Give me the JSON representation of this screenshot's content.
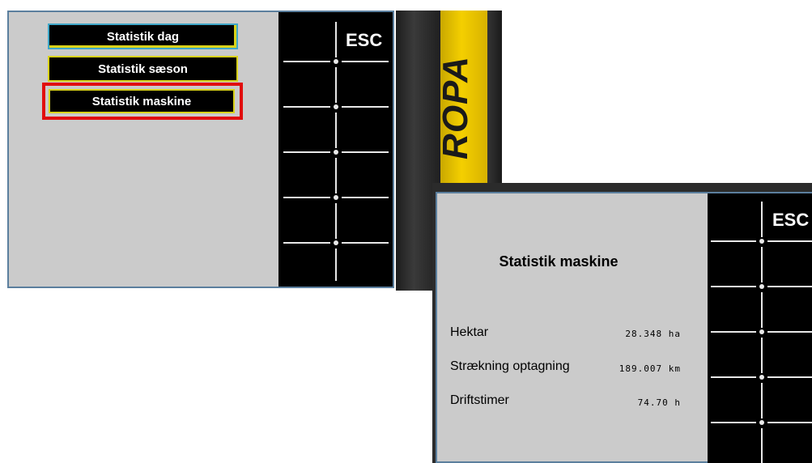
{
  "menu_screen": {
    "buttons": [
      "Statistik dag",
      "Statistik sæson",
      "Statistik maskine"
    ],
    "selected": "Statistik maskine",
    "esc_label": "ESC"
  },
  "brand_strip": {
    "text": "ROPA"
  },
  "stats_screen": {
    "title": "Statistik maskine",
    "esc_label": "ESC",
    "rows": [
      {
        "label": "Hektar",
        "value": "28.348 ha"
      },
      {
        "label": "Strækning optagning",
        "value": "189.007 km"
      },
      {
        "label": "Driftstimer",
        "value": "74.70 h"
      }
    ]
  },
  "colors": {
    "screen_bg": "#cbcbcb",
    "softkey_bg": "#000000",
    "highlight_red": "#e10d0d",
    "button_border_yellow": "#d9d21a",
    "brand_yellow": "#f4cf00"
  }
}
